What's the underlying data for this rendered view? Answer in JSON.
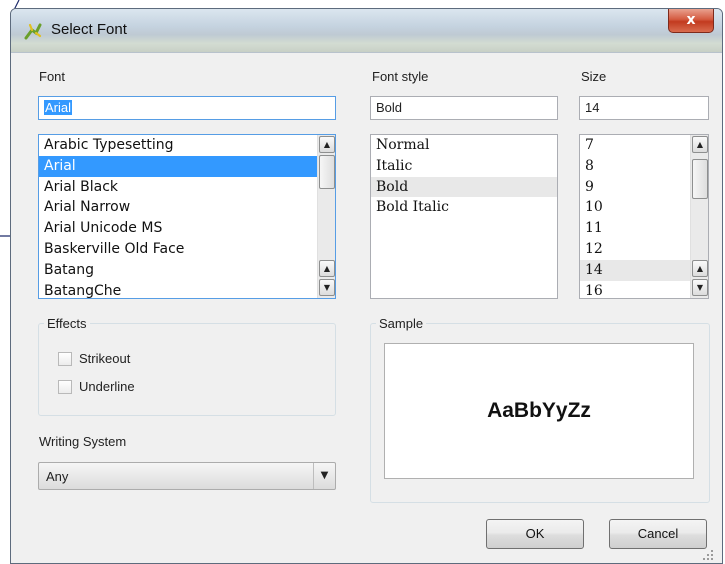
{
  "window": {
    "title": "Select Font",
    "close_symbol": "x",
    "logo_icon": "qgis-logo-icon",
    "close_color": "#c23a1f"
  },
  "font": {
    "label": "Font",
    "value": "Arial",
    "items": [
      "Arabic Typesetting",
      "Arial",
      "Arial Black",
      "Arial Narrow",
      "Arial Unicode MS",
      "Baskerville Old Face",
      "Batang",
      "BatangChe"
    ],
    "selected_index": 1
  },
  "style": {
    "label": "Font style",
    "value": "Bold",
    "items": [
      "Normal",
      "Italic",
      "Bold",
      "Bold Italic"
    ],
    "current_index": 2
  },
  "size": {
    "label": "Size",
    "value": "14",
    "items": [
      "7",
      "8",
      "9",
      "10",
      "11",
      "12",
      "14",
      "16"
    ],
    "current_index": 6
  },
  "effects": {
    "title": "Effects",
    "strikeout": {
      "label": "Strikeout",
      "checked": false
    },
    "underline": {
      "label": "Underline",
      "checked": false
    }
  },
  "writing_system": {
    "label": "Writing System",
    "value": "Any"
  },
  "sample": {
    "title": "Sample",
    "text": "AaBbYyZz"
  },
  "buttons": {
    "ok": "OK",
    "cancel": "Cancel"
  },
  "colors": {
    "selection": "#3399ff",
    "dialog_bg": "#f0f0f0"
  }
}
